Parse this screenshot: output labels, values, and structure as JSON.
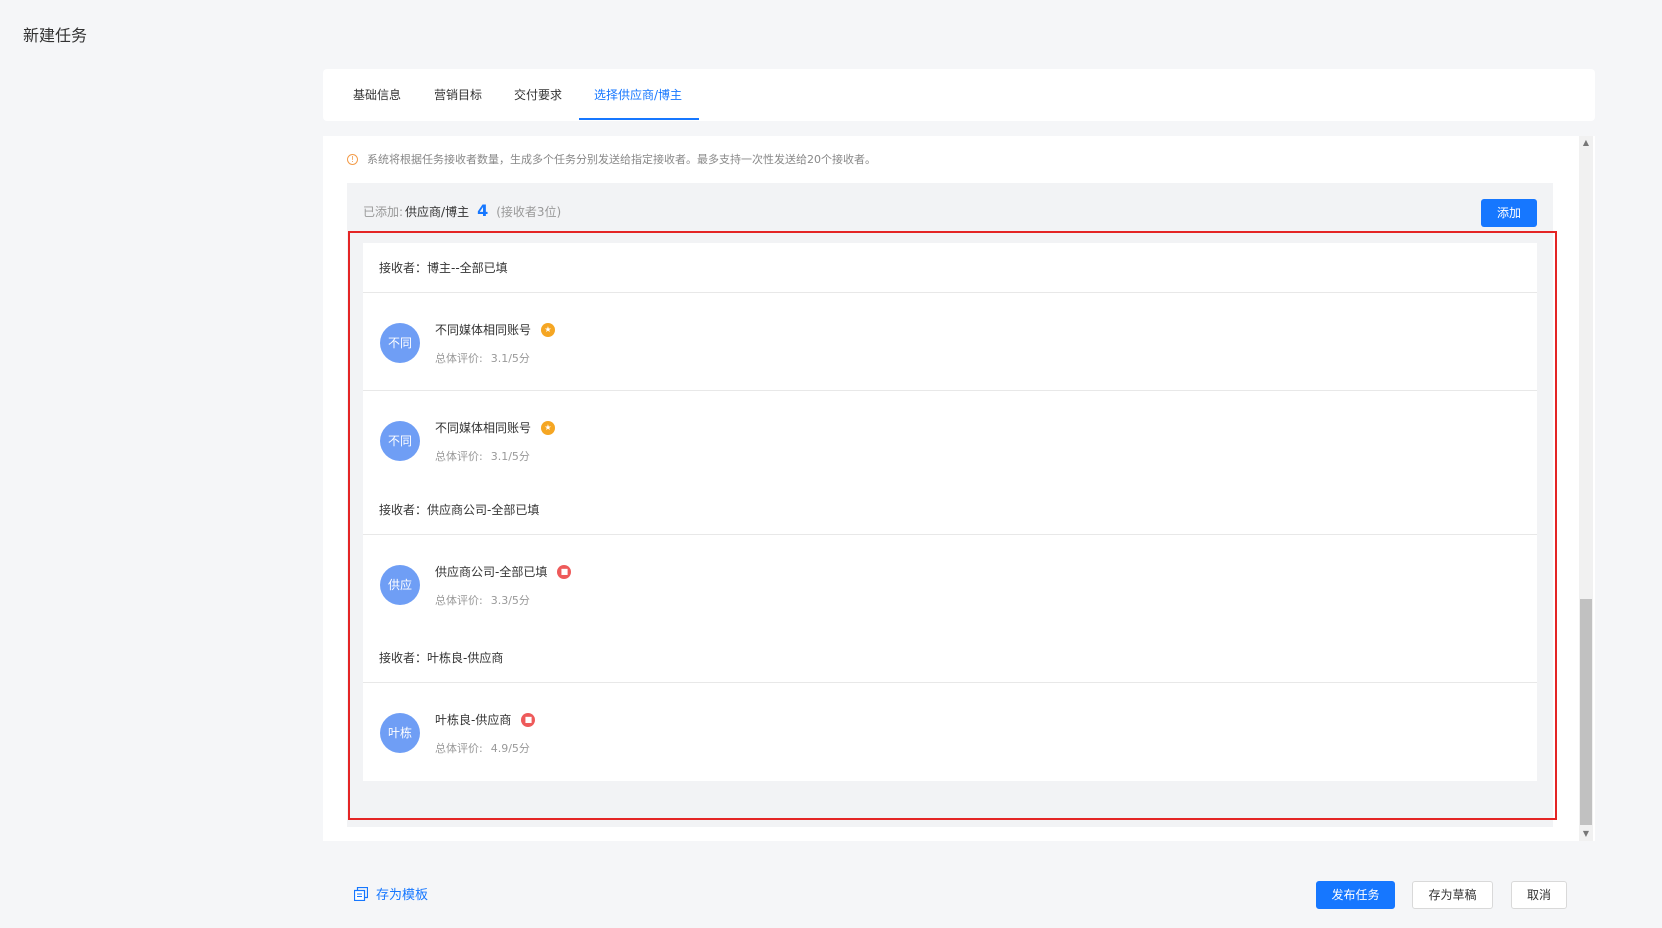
{
  "page": {
    "title": "新建任务"
  },
  "tabs": [
    {
      "label": "基础信息",
      "active": false
    },
    {
      "label": "营销目标",
      "active": false
    },
    {
      "label": "交付要求",
      "active": false
    },
    {
      "label": "选择供应商/博主",
      "active": true
    }
  ],
  "notice": {
    "icon": "info-icon",
    "text": "系统将根据任务接收者数量，生成多个任务分别发送给指定接收者。最多支持一次性发送给20个接收者。"
  },
  "added": {
    "label": "已添加:",
    "type": "供应商/博主",
    "count": "4",
    "receivers": "(接收者3位)",
    "add_button": "添加"
  },
  "groups": [
    {
      "header": "接收者：博主--全部已填",
      "members": [
        {
          "avatar": "不同",
          "name": "不同媒体相同账号",
          "badge_icon": "crown-icon",
          "rating_label": "总体评价:",
          "rating": "3.1/5分"
        },
        {
          "avatar": "不同",
          "name": "不同媒体相同账号",
          "badge_icon": "crown-icon",
          "rating_label": "总体评价:",
          "rating": "3.1/5分"
        }
      ]
    },
    {
      "header": "接收者：供应商公司-全部已填",
      "members": [
        {
          "avatar": "供应",
          "name": "供应商公司-全部已填",
          "badge_icon": "supplier-icon",
          "rating_label": "总体评价:",
          "rating": "3.3/5分"
        }
      ]
    },
    {
      "header": "接收者：叶栋良-供应商",
      "members": [
        {
          "avatar": "叶栋",
          "name": "叶栋良-供应商",
          "badge_icon": "supplier-icon",
          "rating_label": "总体评价:",
          "rating": "4.9/5分"
        }
      ]
    }
  ],
  "footer": {
    "save_template": "存为模板",
    "publish": "发布任务",
    "save_draft": "存为草稿",
    "cancel": "取消"
  },
  "colors": {
    "accent": "#1677ff",
    "highlight": "#e42525",
    "avatar": "#6f9ef5",
    "crown": "#f5a623",
    "supplier": "#ee5a5a"
  }
}
